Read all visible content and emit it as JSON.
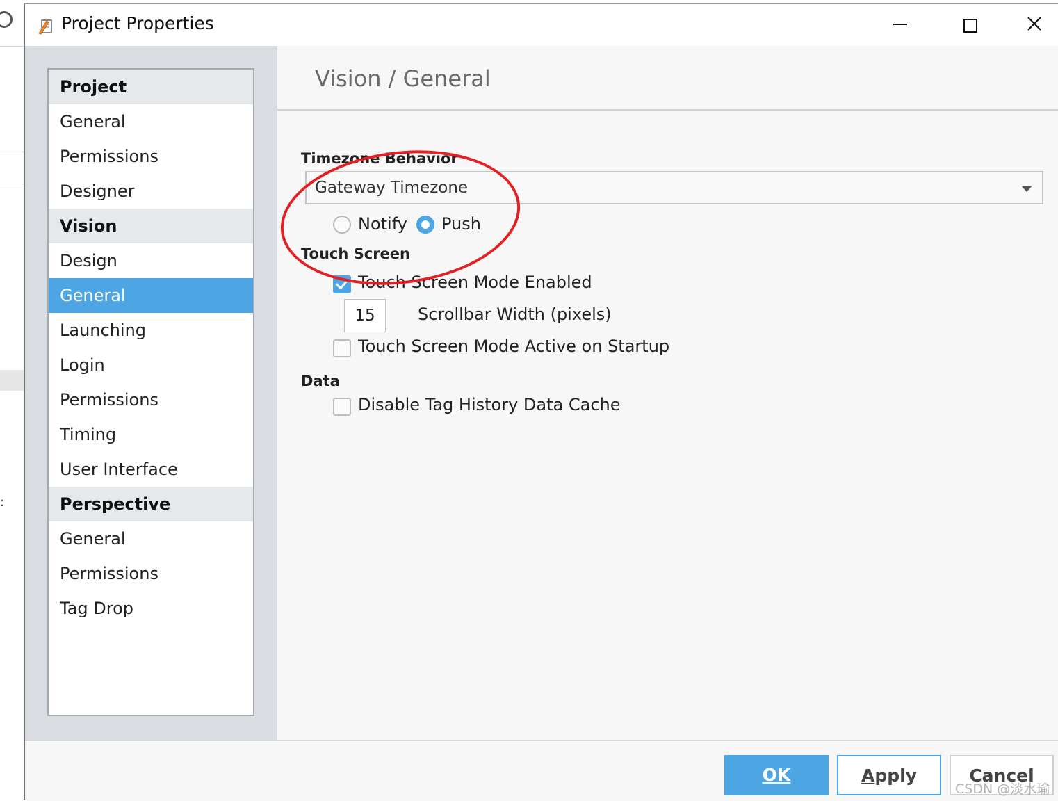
{
  "window": {
    "title": "Project Properties",
    "buttons": {
      "minimize": "minimize",
      "maximize": "maximize",
      "close": "close"
    }
  },
  "nav": {
    "items": [
      {
        "label": "Project",
        "type": "group"
      },
      {
        "label": "General",
        "type": "item"
      },
      {
        "label": "Permissions",
        "type": "item"
      },
      {
        "label": "Designer",
        "type": "item"
      },
      {
        "label": "Vision",
        "type": "group"
      },
      {
        "label": "Design",
        "type": "item"
      },
      {
        "label": "General",
        "type": "item",
        "selected": true
      },
      {
        "label": "Launching",
        "type": "item"
      },
      {
        "label": "Login",
        "type": "item"
      },
      {
        "label": "Permissions",
        "type": "item"
      },
      {
        "label": "Timing",
        "type": "item"
      },
      {
        "label": "User Interface",
        "type": "item"
      },
      {
        "label": "Perspective",
        "type": "group"
      },
      {
        "label": "General",
        "type": "item"
      },
      {
        "label": "Permissions",
        "type": "item"
      },
      {
        "label": "Tag Drop",
        "type": "item"
      }
    ]
  },
  "content": {
    "header": "Vision / General",
    "timezone": {
      "label": "Timezone Behavior",
      "selected": "Gateway Timezone",
      "radios": [
        {
          "label": "Notify",
          "checked": false
        },
        {
          "label": "Push",
          "checked": true
        }
      ]
    },
    "touch": {
      "label": "Touch Screen",
      "mode_enabled": {
        "label": "Touch Screen Mode Enabled",
        "checked": true
      },
      "scrollbar": {
        "value": "15",
        "label": "Scrollbar Width (pixels)"
      },
      "active_startup": {
        "label": "Touch Screen Mode Active on Startup",
        "checked": false
      }
    },
    "data": {
      "label": "Data",
      "disable_cache": {
        "label": "Disable Tag History Data Cache",
        "checked": false
      }
    }
  },
  "footer": {
    "ok": {
      "mnemonic": "O",
      "rest": "K"
    },
    "apply": {
      "mnemonic": "A",
      "rest": "pply"
    },
    "cancel": {
      "mnemonic": "",
      "rest": "Cancel"
    }
  },
  "watermark": "CSDN @淡水瑜",
  "colors": {
    "accent": "#4da6e3",
    "annotation": "#e32024",
    "nav_group_bg": "#e6e9ec",
    "left_pane_bg": "#d9dde1",
    "content_bg": "#f7f7f7"
  }
}
